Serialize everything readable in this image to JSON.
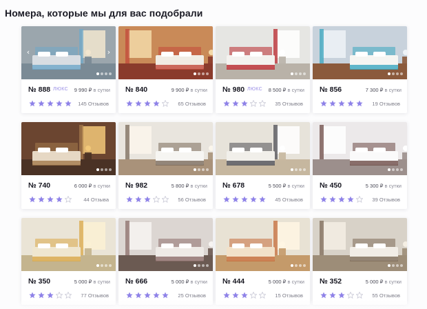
{
  "page": {
    "title": "Номера, которые мы для вас подобрали"
  },
  "colors": {
    "star_filled": "#8f83e8",
    "star_empty": "#c9c9d6",
    "lux": "#9a8fe6"
  },
  "rooms": [
    {
      "number": "№ 888",
      "badge": "ЛЮКС",
      "price": "9 990 ₽",
      "per": "в сутки",
      "rating": 5,
      "reviews": "145 Отзывов",
      "arrows": true
    },
    {
      "number": "№ 840",
      "badge": "",
      "price": "9 900 ₽",
      "per": "в сутки",
      "rating": 4,
      "reviews": "65 Отзывов",
      "arrows": false
    },
    {
      "number": "№ 980",
      "badge": "ЛЮКС",
      "price": "8 500 ₽",
      "per": "в сутки",
      "rating": 3,
      "reviews": "35 Отзывов",
      "arrows": false
    },
    {
      "number": "№ 856",
      "badge": "",
      "price": "7 300 ₽",
      "per": "в сутки",
      "rating": 5,
      "reviews": "19 Отзывов",
      "arrows": false
    },
    {
      "number": "№ 740",
      "badge": "",
      "price": "6 000 ₽",
      "per": "в сутки",
      "rating": 4,
      "reviews": "44 Отзыва",
      "arrows": false
    },
    {
      "number": "№ 982",
      "badge": "",
      "price": "5 800 ₽",
      "per": "в сутки",
      "rating": 3,
      "reviews": "56 Отзывов",
      "arrows": false
    },
    {
      "number": "№ 678",
      "badge": "",
      "price": "5 500 ₽",
      "per": "в сутки",
      "rating": 5,
      "reviews": "45 Отзывов",
      "arrows": false
    },
    {
      "number": "№ 450",
      "badge": "",
      "price": "5 300 ₽",
      "per": "в сутки",
      "rating": 4,
      "reviews": "39 Отзывов",
      "arrows": false
    },
    {
      "number": "№ 350",
      "badge": "",
      "price": "5 000 ₽",
      "per": "в сутки",
      "rating": 3,
      "reviews": "77 Отзывов",
      "arrows": false
    },
    {
      "number": "№ 666",
      "badge": "",
      "price": "5 000 ₽",
      "per": "в сутки",
      "rating": 5,
      "reviews": "25 Отзывов",
      "arrows": false
    },
    {
      "number": "№ 444",
      "badge": "",
      "price": "5 000 ₽",
      "per": "в сутки",
      "rating": 3,
      "reviews": "15 Отзывов",
      "arrows": false
    },
    {
      "number": "№ 352",
      "badge": "",
      "price": "5 000 ₽",
      "per": "в сутки",
      "rating": 3,
      "reviews": "55 Отзывов",
      "arrows": false
    }
  ],
  "photos": [
    {
      "wall": "#9ba6ad",
      "floor": "#7a8a95",
      "bed": "#d8dde2",
      "accent": "#6fa8c9",
      "light": "#f2e6cf"
    },
    {
      "wall": "#c98a58",
      "floor": "#8a3b2c",
      "bed": "#f1ece4",
      "accent": "#c2483a",
      "light": "#f3d9a8"
    },
    {
      "wall": "#e6e6e3",
      "floor": "#b9b2a8",
      "bed": "#f4f2ef",
      "accent": "#b8262c",
      "light": "#ffffff"
    },
    {
      "wall": "#c8d2dc",
      "floor": "#8b5a3c",
      "bed": "#f5f5f2",
      "accent": "#3aa6bf",
      "light": "#eef3f7"
    },
    {
      "wall": "#6b4530",
      "floor": "#4a3225",
      "bed": "#e6d8c4",
      "accent": "#a47a4c",
      "light": "#f2c879"
    },
    {
      "wall": "#e9e5de",
      "floor": "#a9927a",
      "bed": "#f6f5f2",
      "accent": "#7a6a5a",
      "light": "#fbf6ec"
    },
    {
      "wall": "#e7e3da",
      "floor": "#c6b79f",
      "bed": "#f1efea",
      "accent": "#4e4e54",
      "light": "#ffffff"
    },
    {
      "wall": "#ece9ea",
      "floor": "#9c8f8c",
      "bed": "#fafafa",
      "accent": "#6d4b46",
      "light": "#ffffff"
    },
    {
      "wall": "#eae4d6",
      "floor": "#c4b48e",
      "bed": "#efe6cf",
      "accent": "#d9a848",
      "light": "#fbf1d4"
    },
    {
      "wall": "#dcd6d2",
      "floor": "#6b5a52",
      "bed": "#eeeae6",
      "accent": "#8c6d6a",
      "light": "#f7f4f2"
    },
    {
      "wall": "#e8e2d4",
      "floor": "#c49a6a",
      "bed": "#f2e1c9",
      "accent": "#c46b3a",
      "light": "#fff6e3"
    },
    {
      "wall": "#d8d2c8",
      "floor": "#9d8d78",
      "bed": "#f1ede6",
      "accent": "#7d6a58",
      "light": "#f5efe4"
    }
  ]
}
